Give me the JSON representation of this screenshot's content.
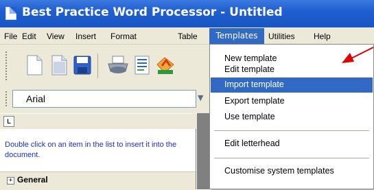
{
  "window": {
    "title": "Best Practice Word Processor - Untitled"
  },
  "menu": {
    "items": [
      "File",
      "Edit",
      "View",
      "Insert",
      "Format",
      "Table",
      "Templates",
      "Utilities",
      "Help"
    ],
    "active": "Templates"
  },
  "toolbar": {
    "icons": [
      "new-document-icon",
      "open-document-icon",
      "save-icon",
      "print-icon",
      "print-preview-icon",
      "spellcheck-icon"
    ]
  },
  "font": {
    "name": "Arial"
  },
  "panel": {
    "button_label": "L",
    "hint": "Double click on an item in the list to insert it into the document.",
    "tree_root": "General"
  },
  "templates_menu": {
    "items": [
      "New template",
      "Edit template",
      "Import template",
      "Export template",
      "Use template",
      "Edit letterhead",
      "Customise system templates"
    ],
    "highlighted": "Import template"
  },
  "colors": {
    "titlebar": "#1f5fd0",
    "highlight": "#316ac5",
    "hint_text": "#1a2fd6",
    "annotation": "#e00000"
  }
}
